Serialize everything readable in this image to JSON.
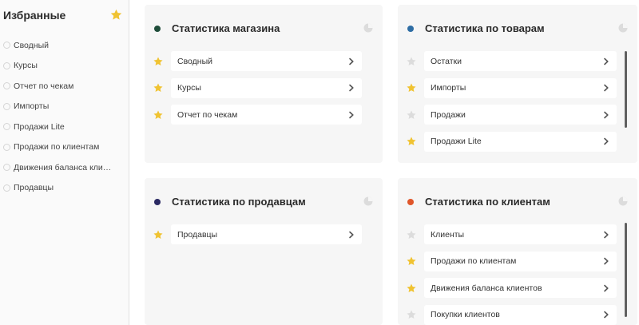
{
  "sidebar": {
    "title": "Избранные",
    "star_icon": "star-icon",
    "items": [
      {
        "label": "Сводный"
      },
      {
        "label": "Курсы"
      },
      {
        "label": "Отчет по чекам"
      },
      {
        "label": "Импорты"
      },
      {
        "label": "Продажи Lite"
      },
      {
        "label": "Продажи по клиентам"
      },
      {
        "label": "Движения баланса кли…"
      },
      {
        "label": "Продавцы"
      }
    ]
  },
  "colors": {
    "star_active": "#f0c332",
    "star_inactive": "#dcdcdc",
    "dot_store": "#1f4d3a",
    "dot_products": "#2e6da4",
    "dot_sellers": "#2b2a63",
    "dot_clients": "#e0562a"
  },
  "cards": {
    "store": {
      "title": "Статистика магазина",
      "rows": [
        {
          "label": "Сводный",
          "starred": true
        },
        {
          "label": "Курсы",
          "starred": true
        },
        {
          "label": "Отчет по чекам",
          "starred": true
        }
      ]
    },
    "products": {
      "title": "Статистика по товарам",
      "rows": [
        {
          "label": "Остатки",
          "starred": false
        },
        {
          "label": "Импорты",
          "starred": true
        },
        {
          "label": "Продажи",
          "starred": false
        },
        {
          "label": "Продажи Lite",
          "starred": true
        }
      ]
    },
    "sellers": {
      "title": "Статистика по продавцам",
      "rows": [
        {
          "label": "Продавцы",
          "starred": true
        }
      ]
    },
    "clients": {
      "title": "Статистика по клиентам",
      "rows": [
        {
          "label": "Клиенты",
          "starred": false
        },
        {
          "label": "Продажи по клиентам",
          "starred": true
        },
        {
          "label": "Движения баланса клиентов",
          "starred": true
        },
        {
          "label": "Покупки клиентов",
          "starred": false
        }
      ]
    }
  }
}
